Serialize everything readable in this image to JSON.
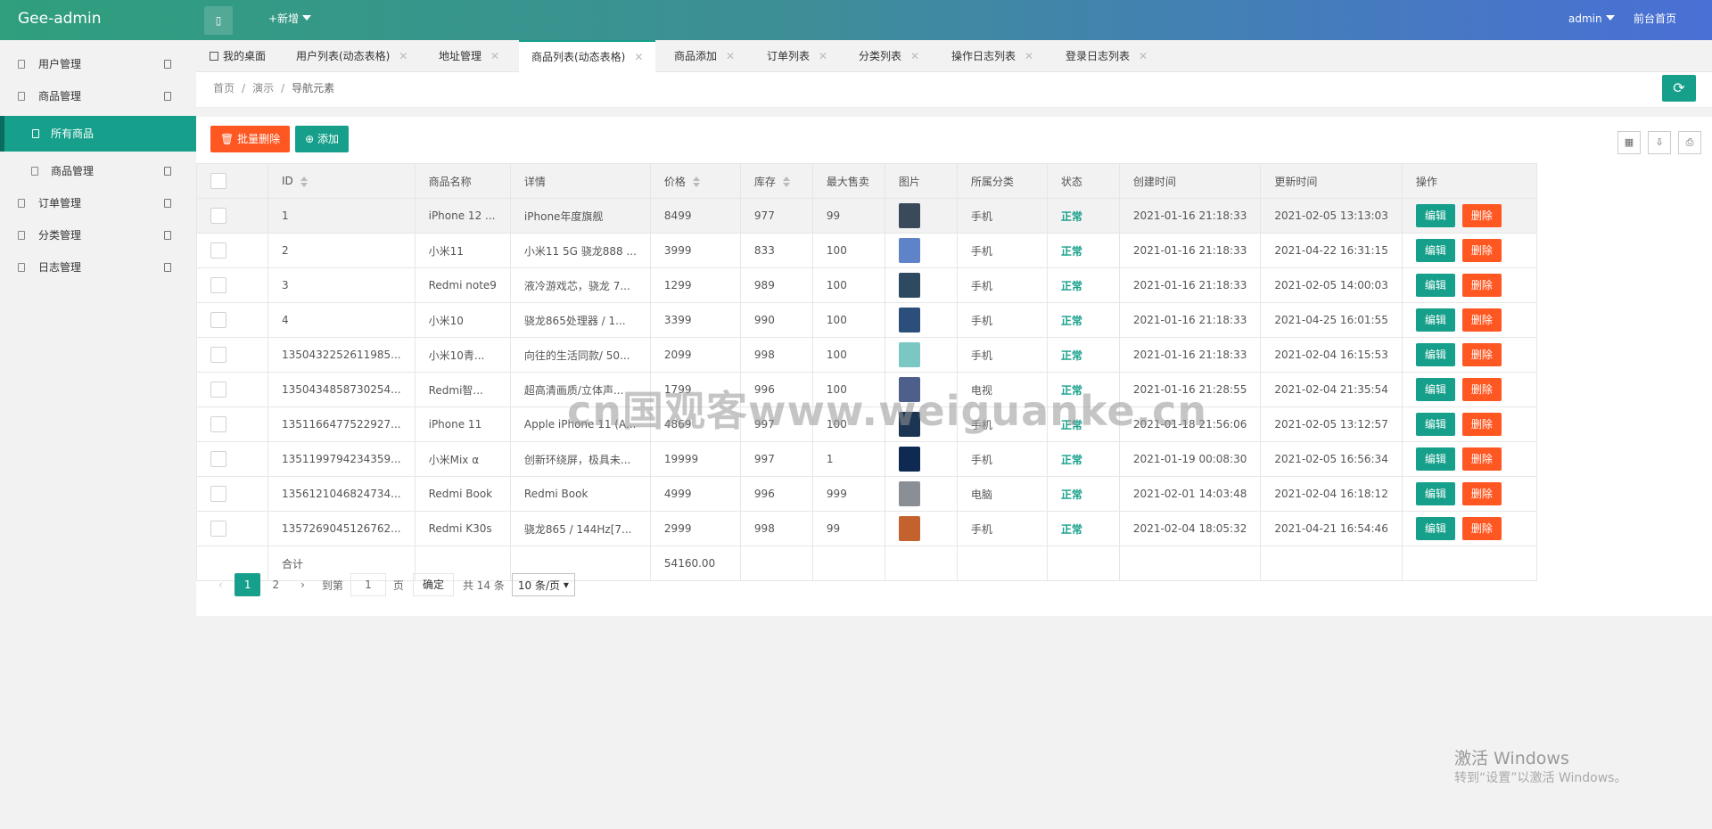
{
  "header": {
    "logo": "Gee-admin",
    "menu_toggle": "▯",
    "new_label": "+新增",
    "user": "admin",
    "home_link": "前台首页"
  },
  "sidebar": {
    "items": [
      {
        "label": "用户管理"
      },
      {
        "label": "商品管理"
      },
      {
        "label": "所有商品"
      },
      {
        "label": "商品管理"
      },
      {
        "label": "订单管理"
      },
      {
        "label": "分类管理"
      },
      {
        "label": "日志管理"
      }
    ]
  },
  "tabs": [
    {
      "label": "我的桌面"
    },
    {
      "label": "用户列表(动态表格)"
    },
    {
      "label": "地址管理"
    },
    {
      "label": "商品列表(动态表格)"
    },
    {
      "label": "商品添加"
    },
    {
      "label": "订单列表"
    },
    {
      "label": "分类列表"
    },
    {
      "label": "操作日志列表"
    },
    {
      "label": "登录日志列表"
    }
  ],
  "breadcrumb": {
    "home": "首页",
    "demo": "演示",
    "current": "导航元素",
    "sep": "/"
  },
  "toolbar": {
    "batch_delete": "批量删除",
    "add": "添加"
  },
  "table": {
    "columns": [
      "ID",
      "商品名称",
      "详情",
      "价格",
      "库存",
      "最大售卖",
      "图片",
      "所属分类",
      "状态",
      "创建时间",
      "更新时间",
      "操作"
    ],
    "rows": [
      {
        "id": "1",
        "name": "iPhone 12 ...",
        "detail": "iPhone年度旗舰",
        "price": "8499",
        "stock": "977",
        "max": "99",
        "img_color": "#3b4a5a",
        "cat": "手机",
        "status": "正常",
        "created": "2021-01-16 21:18:33",
        "updated": "2021-02-05 13:13:03"
      },
      {
        "id": "2",
        "name": "小米11",
        "detail": "小米11 5G 骁龙888 ...",
        "price": "3999",
        "stock": "833",
        "max": "100",
        "img_color": "#5f83c9",
        "cat": "手机",
        "status": "正常",
        "created": "2021-01-16 21:18:33",
        "updated": "2021-04-22 16:31:15"
      },
      {
        "id": "3",
        "name": "Redmi note9",
        "detail": "液冷游戏芯，骁龙 7...",
        "price": "1299",
        "stock": "989",
        "max": "100",
        "img_color": "#2d4a60",
        "cat": "手机",
        "status": "正常",
        "created": "2021-01-16 21:18:33",
        "updated": "2021-02-05 14:00:03"
      },
      {
        "id": "4",
        "name": "小米10",
        "detail": "骁龙865处理器 / 1...",
        "price": "3399",
        "stock": "990",
        "max": "100",
        "img_color": "#2b4f7a",
        "cat": "手机",
        "status": "正常",
        "created": "2021-01-16 21:18:33",
        "updated": "2021-04-25 16:01:55"
      },
      {
        "id": "1350432252611985...",
        "name": "小米10青...",
        "detail": "向往的生活同款/ 50...",
        "price": "2099",
        "stock": "998",
        "max": "100",
        "img_color": "#7ac7c4",
        "cat": "手机",
        "status": "正常",
        "created": "2021-01-16 21:18:33",
        "updated": "2021-02-04 16:15:53"
      },
      {
        "id": "1350434858730254...",
        "name": "Redmi智...",
        "detail": "超高清画质/立体声...",
        "price": "1799",
        "stock": "996",
        "max": "100",
        "img_color": "#4d5f8a",
        "cat": "电视",
        "status": "正常",
        "created": "2021-01-16 21:28:55",
        "updated": "2021-02-04 21:35:54"
      },
      {
        "id": "1351166477522927...",
        "name": "iPhone 11",
        "detail": "Apple iPhone 11 (A...",
        "price": "4869",
        "stock": "997",
        "max": "100",
        "img_color": "#1c3553",
        "cat": "手机",
        "status": "正常",
        "created": "2021-01-18 21:56:06",
        "updated": "2021-02-05 13:12:57"
      },
      {
        "id": "1351199794234359...",
        "name": "小米Mix α",
        "detail": "创新环绕屏，极具未...",
        "price": "19999",
        "stock": "997",
        "max": "1",
        "img_color": "#0e2a52",
        "cat": "手机",
        "status": "正常",
        "created": "2021-01-19 00:08:30",
        "updated": "2021-02-05 16:56:34"
      },
      {
        "id": "1356121046824734...",
        "name": "Redmi Book",
        "detail": "Redmi Book",
        "price": "4999",
        "stock": "996",
        "max": "999",
        "img_color": "#8a8f96",
        "cat": "电脑",
        "status": "正常",
        "created": "2021-02-01 14:03:48",
        "updated": "2021-02-04 16:18:12"
      },
      {
        "id": "1357269045126762...",
        "name": "Redmi K30s",
        "detail": "骁龙865 / 144Hz[7...",
        "price": "2999",
        "stock": "998",
        "max": "99",
        "img_color": "#c4622f",
        "cat": "手机",
        "status": "正常",
        "created": "2021-02-04 18:05:32",
        "updated": "2021-04-21 16:54:46"
      }
    ],
    "edit_label": "编辑",
    "delete_label": "删除",
    "total_label": "合计",
    "total_price": "54160.00"
  },
  "pager": {
    "prev": "‹",
    "pages": [
      "1",
      "2"
    ],
    "next": "›",
    "goto_label": "到第",
    "goto_value": "1",
    "page_unit": "页",
    "confirm": "确定",
    "total": "共 14 条",
    "per_page": "10 条/页"
  },
  "watermark": "cn国观客www.weiguanke.cn",
  "activation": {
    "line1": "激活 Windows",
    "line2": "转到“设置”以激活 Windows。"
  }
}
